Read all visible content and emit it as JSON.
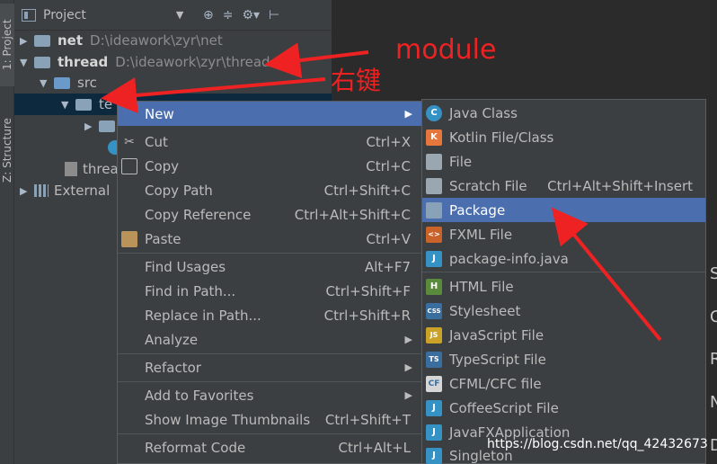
{
  "left_tabs": {
    "project": "1: Project",
    "structure": "Z: Structure"
  },
  "panel": {
    "title": "Project",
    "tools": [
      "⊕",
      "≑",
      "⚙▾",
      "⊢"
    ]
  },
  "tree": [
    {
      "name": "net",
      "path": "D:\\ideawork\\zyr\\net"
    },
    {
      "name": "thread",
      "path": "D:\\ideawork\\zyr\\thread"
    },
    {
      "name": "src"
    },
    {
      "name": "te"
    },
    {
      "name": "threa"
    },
    {
      "name": "External"
    }
  ],
  "menu": [
    {
      "label": "New",
      "shortcut": ""
    },
    {
      "label": "Cut",
      "shortcut": "Ctrl+X"
    },
    {
      "label": "Copy",
      "shortcut": "Ctrl+C"
    },
    {
      "label": "Copy Path",
      "shortcut": "Ctrl+Shift+C"
    },
    {
      "label": "Copy Reference",
      "shortcut": "Ctrl+Alt+Shift+C"
    },
    {
      "label": "Paste",
      "shortcut": "Ctrl+V"
    },
    {
      "label": "Find Usages",
      "shortcut": "Alt+F7"
    },
    {
      "label": "Find in Path...",
      "shortcut": "Ctrl+Shift+F"
    },
    {
      "label": "Replace in Path...",
      "shortcut": "Ctrl+Shift+R"
    },
    {
      "label": "Analyze",
      "shortcut": ""
    },
    {
      "label": "Refactor",
      "shortcut": ""
    },
    {
      "label": "Add to Favorites",
      "shortcut": ""
    },
    {
      "label": "Show Image Thumbnails",
      "shortcut": "Ctrl+Shift+T"
    },
    {
      "label": "Reformat Code",
      "shortcut": "Ctrl+Alt+L"
    }
  ],
  "submenu": [
    {
      "label": "Java Class",
      "shortcut": "",
      "icon": "C"
    },
    {
      "label": "Kotlin File/Class",
      "shortcut": "",
      "icon": "K"
    },
    {
      "label": "File",
      "shortcut": "",
      "icon": ""
    },
    {
      "label": "Scratch File",
      "shortcut": "Ctrl+Alt+Shift+Insert",
      "icon": ""
    },
    {
      "label": "Package",
      "shortcut": "",
      "icon": ""
    },
    {
      "label": "FXML File",
      "shortcut": "",
      "icon": "<>"
    },
    {
      "label": "package-info.java",
      "shortcut": "",
      "icon": "J"
    },
    {
      "label": "HTML File",
      "shortcut": "",
      "icon": "H"
    },
    {
      "label": "Stylesheet",
      "shortcut": "",
      "icon": "CSS"
    },
    {
      "label": "JavaScript File",
      "shortcut": "",
      "icon": "JS"
    },
    {
      "label": "TypeScript File",
      "shortcut": "",
      "icon": "TS"
    },
    {
      "label": "CFML/CFC file",
      "shortcut": "",
      "icon": "CF"
    },
    {
      "label": "CoffeeScript File",
      "shortcut": "",
      "icon": "J"
    },
    {
      "label": "JavaFXApplication",
      "shortcut": "",
      "icon": "J"
    },
    {
      "label": "Singleton",
      "shortcut": "",
      "icon": "J"
    }
  ],
  "annotations": {
    "module": "module",
    "right_click": "右键"
  },
  "editor_edge": [
    "S",
    "C",
    "R",
    "N",
    "D"
  ],
  "watermark": "https://blog.csdn.net/qq_42432673",
  "colors": {
    "highlight": "#4b6eaf",
    "annotation": "#ee2222",
    "panel": "#3c3f41"
  }
}
